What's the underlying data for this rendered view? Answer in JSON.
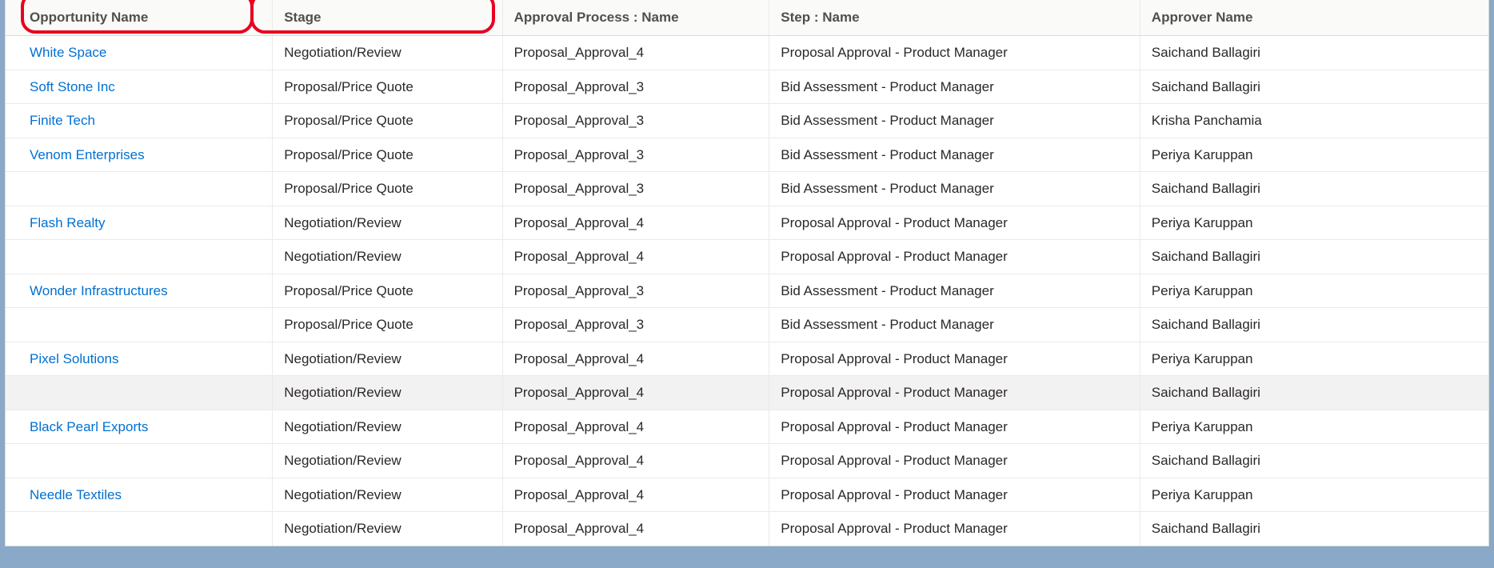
{
  "table": {
    "headers": {
      "opportunity": "Opportunity Name",
      "stage": "Stage",
      "process": "Approval Process : Name",
      "step": "Step : Name",
      "approver": "Approver Name"
    },
    "rows": [
      {
        "opp": "White Space",
        "stage": "Negotiation/Review",
        "proc": "Proposal_Approval_4",
        "step": "Proposal Approval - Product Manager",
        "appr": "Saichand Ballagiri",
        "link": true,
        "hover": false
      },
      {
        "opp": "Soft Stone Inc",
        "stage": "Proposal/Price Quote",
        "proc": "Proposal_Approval_3",
        "step": "Bid Assessment - Product Manager",
        "appr": "Saichand Ballagiri",
        "link": true,
        "hover": false
      },
      {
        "opp": "Finite Tech",
        "stage": "Proposal/Price Quote",
        "proc": "Proposal_Approval_3",
        "step": "Bid Assessment - Product Manager",
        "appr": "Krisha Panchamia",
        "link": true,
        "hover": false
      },
      {
        "opp": "Venom Enterprises",
        "stage": "Proposal/Price Quote",
        "proc": "Proposal_Approval_3",
        "step": "Bid Assessment - Product Manager",
        "appr": "Periya Karuppan",
        "link": true,
        "hover": false
      },
      {
        "opp": "",
        "stage": "Proposal/Price Quote",
        "proc": "Proposal_Approval_3",
        "step": "Bid Assessment - Product Manager",
        "appr": "Saichand Ballagiri",
        "link": false,
        "hover": false
      },
      {
        "opp": "Flash Realty",
        "stage": "Negotiation/Review",
        "proc": "Proposal_Approval_4",
        "step": "Proposal Approval - Product Manager",
        "appr": "Periya Karuppan",
        "link": true,
        "hover": false
      },
      {
        "opp": "",
        "stage": "Negotiation/Review",
        "proc": "Proposal_Approval_4",
        "step": "Proposal Approval - Product Manager",
        "appr": "Saichand Ballagiri",
        "link": false,
        "hover": false
      },
      {
        "opp": "Wonder Infrastructures",
        "stage": "Proposal/Price Quote",
        "proc": "Proposal_Approval_3",
        "step": "Bid Assessment - Product Manager",
        "appr": "Periya Karuppan",
        "link": true,
        "hover": false
      },
      {
        "opp": "",
        "stage": "Proposal/Price Quote",
        "proc": "Proposal_Approval_3",
        "step": "Bid Assessment - Product Manager",
        "appr": "Saichand Ballagiri",
        "link": false,
        "hover": false
      },
      {
        "opp": "Pixel Solutions",
        "stage": "Negotiation/Review",
        "proc": "Proposal_Approval_4",
        "step": "Proposal Approval - Product Manager",
        "appr": "Periya Karuppan",
        "link": true,
        "hover": false
      },
      {
        "opp": "",
        "stage": "Negotiation/Review",
        "proc": "Proposal_Approval_4",
        "step": "Proposal Approval - Product Manager",
        "appr": "Saichand Ballagiri",
        "link": false,
        "hover": true
      },
      {
        "opp": "Black Pearl Exports",
        "stage": "Negotiation/Review",
        "proc": "Proposal_Approval_4",
        "step": "Proposal Approval - Product Manager",
        "appr": "Periya Karuppan",
        "link": true,
        "hover": false
      },
      {
        "opp": "",
        "stage": "Negotiation/Review",
        "proc": "Proposal_Approval_4",
        "step": "Proposal Approval - Product Manager",
        "appr": "Saichand Ballagiri",
        "link": false,
        "hover": false
      },
      {
        "opp": "Needle Textiles",
        "stage": "Negotiation/Review",
        "proc": "Proposal_Approval_4",
        "step": "Proposal Approval - Product Manager",
        "appr": "Periya Karuppan",
        "link": true,
        "hover": false
      },
      {
        "opp": "",
        "stage": "Negotiation/Review",
        "proc": "Proposal_Approval_4",
        "step": "Proposal Approval - Product Manager",
        "appr": "Saichand Ballagiri",
        "link": false,
        "hover": false
      }
    ]
  },
  "callouts": {
    "highlight_headers": [
      "opportunity",
      "stage"
    ]
  },
  "colors": {
    "link": "#0070d2",
    "header_bg": "#fafaf9",
    "border": "#dddbda",
    "callout": "#e8001f",
    "page_bg": "#8aa9c8"
  }
}
